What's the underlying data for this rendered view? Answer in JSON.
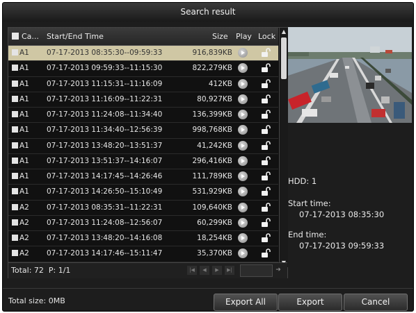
{
  "window": {
    "title": "Search result"
  },
  "table": {
    "columns": {
      "camera": "Ca...",
      "time": "Start/End Time",
      "size": "Size",
      "play": "Play",
      "lock": "Lock"
    },
    "rows": [
      {
        "camera": "A1",
        "time": "07-17-2013 08:35:30--09:59:33",
        "size": "916,839KB",
        "selected": true
      },
      {
        "camera": "A1",
        "time": "07-17-2013 09:59:33--11:15:30",
        "size": "822,279KB"
      },
      {
        "camera": "A1",
        "time": "07-17-2013 11:15:31--11:16:09",
        "size": "412KB"
      },
      {
        "camera": "A1",
        "time": "07-17-2013 11:16:09--11:22:31",
        "size": "80,927KB"
      },
      {
        "camera": "A1",
        "time": "07-17-2013 11:24:08--11:34:40",
        "size": "136,399KB"
      },
      {
        "camera": "A1",
        "time": "07-17-2013 11:34:40--12:56:39",
        "size": "998,768KB"
      },
      {
        "camera": "A1",
        "time": "07-17-2013 13:48:20--13:51:37",
        "size": "41,242KB"
      },
      {
        "camera": "A1",
        "time": "07-17-2013 13:51:37--14:16:07",
        "size": "296,416KB"
      },
      {
        "camera": "A1",
        "time": "07-17-2013 14:17:45--14:26:46",
        "size": "111,789KB"
      },
      {
        "camera": "A1",
        "time": "07-17-2013 14:26:50--15:10:49",
        "size": "531,929KB"
      },
      {
        "camera": "A2",
        "time": "07-17-2013 08:35:31--11:22:31",
        "size": "109,640KB"
      },
      {
        "camera": "A2",
        "time": "07-17-2013 11:24:08--12:56:07",
        "size": "60,299KB"
      },
      {
        "camera": "A2",
        "time": "07-17-2013 13:48:20--14:16:08",
        "size": "18,254KB"
      },
      {
        "camera": "A2",
        "time": "07-17-2013 14:17:46--15:11:47",
        "size": "35,370KB"
      }
    ]
  },
  "pagination": {
    "total": "Total: 72",
    "page": "P: 1/1"
  },
  "info": {
    "hdd": "HDD: 1",
    "start_label": "Start time:",
    "start_value": "07-17-2013 08:35:30",
    "end_label": "End time:",
    "end_value": "07-17-2013 09:59:33"
  },
  "footer": {
    "total_size": "Total size: 0MB"
  },
  "buttons": {
    "export_all": "Export All",
    "export": "Export",
    "cancel": "Cancel"
  },
  "icons": {
    "play": "play-icon",
    "lock": "unlock-icon",
    "nav": [
      "first-page-icon",
      "prev-page-icon",
      "next-page-icon",
      "last-page-icon"
    ]
  },
  "colors": {
    "background": "#1d1d1d",
    "selected_row": "#cfc7a4",
    "text": "#e6e6e6"
  }
}
